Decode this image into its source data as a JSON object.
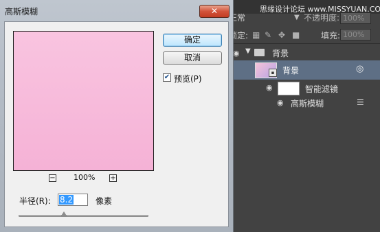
{
  "dialog": {
    "title": "高斯模糊",
    "close_icon": "close-icon",
    "ok_label": "确定",
    "cancel_label": "取消",
    "preview_checked": true,
    "preview_label": "预览(P)",
    "zoom_level": "100%",
    "zoom_out_glyph": "−",
    "zoom_in_glyph": "+",
    "radius_label": "半径(R):",
    "radius_value": "8.2",
    "radius_unit": "像素",
    "radius_slider_fraction": 0.35,
    "preview_color": "#f7bddc",
    "accent_color": "#3399ff"
  },
  "photoshop": {
    "watermark": "思缘设计论坛 www.MISSYUAN.COM",
    "blend_mode": "正常",
    "opacity_label": "不透明度:",
    "opacity_value": "100%",
    "lock_label": "锁定:",
    "fill_label": "填充:",
    "fill_value": "100%",
    "layers": {
      "group_name": "背景",
      "layer_name": "背景",
      "smart_filters_label": "智能滤镜",
      "filter_name": "高斯模糊"
    },
    "selected_layer_color": "#5e6f85"
  }
}
